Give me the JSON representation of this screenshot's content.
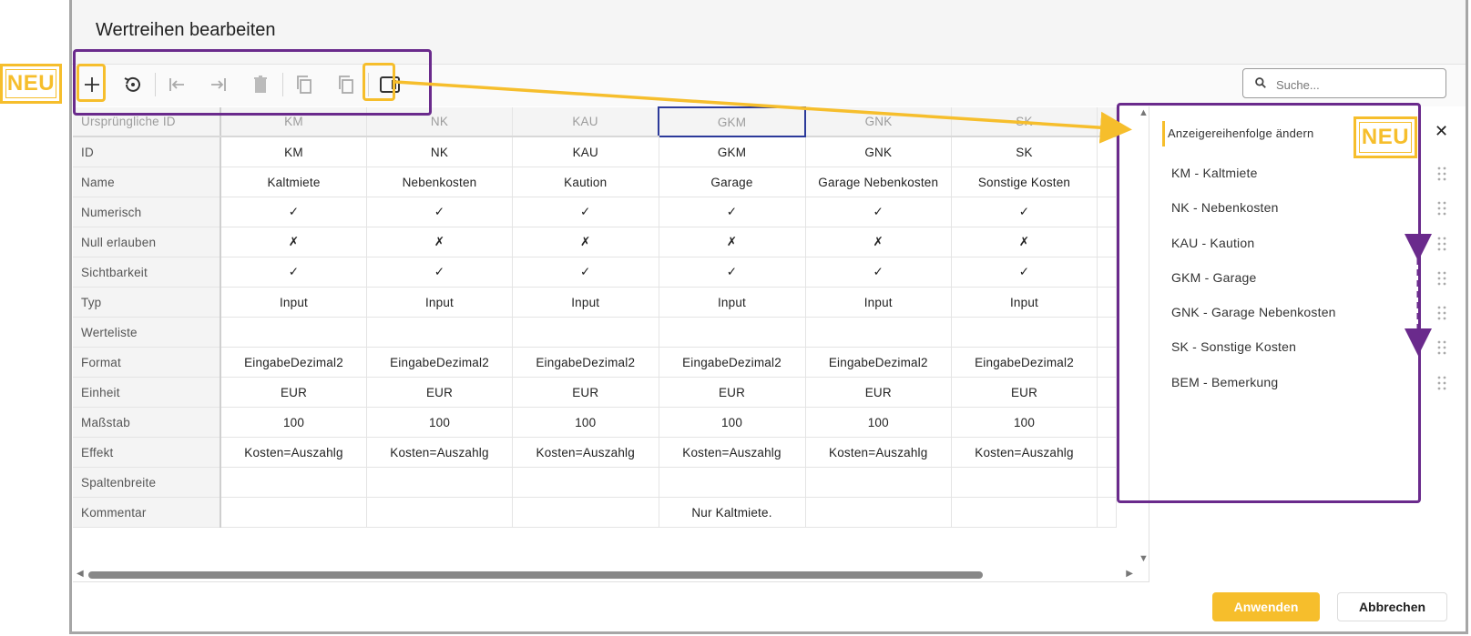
{
  "dialog": {
    "title": "Wertreihen bearbeiten"
  },
  "search": {
    "placeholder": "Suche..."
  },
  "toolbar": {
    "icons": [
      "add-icon",
      "reset-icon",
      "move-left-icon",
      "move-right-icon",
      "delete-icon",
      "copy-icon",
      "duplicate-icon",
      "panel-toggle-icon"
    ]
  },
  "grid": {
    "header_label": "Ursprüngliche ID",
    "columns": [
      "KM",
      "NK",
      "KAU",
      "GKM",
      "GNK",
      "SK"
    ],
    "rows": [
      {
        "label": "ID",
        "cells": [
          "KM",
          "NK",
          "KAU",
          "GKM",
          "GNK",
          "SK"
        ]
      },
      {
        "label": "Name",
        "cells": [
          "Kaltmiete",
          "Nebenkosten",
          "Kaution",
          "Garage",
          "Garage Nebenkosten",
          "Sonstige Kosten"
        ]
      },
      {
        "label": "Numerisch",
        "cells": [
          "✓",
          "✓",
          "✓",
          "✓",
          "✓",
          "✓"
        ]
      },
      {
        "label": "Null erlauben",
        "cells": [
          "✗",
          "✗",
          "✗",
          "✗",
          "✗",
          "✗"
        ]
      },
      {
        "label": "Sichtbarkeit",
        "cells": [
          "✓",
          "✓",
          "✓",
          "✓",
          "✓",
          "✓"
        ]
      },
      {
        "label": "Typ",
        "cells": [
          "Input",
          "Input",
          "Input",
          "Input",
          "Input",
          "Input"
        ]
      },
      {
        "label": "Werteliste",
        "cells": [
          "",
          "",
          "",
          "",
          "",
          ""
        ]
      },
      {
        "label": "Format",
        "cells": [
          "EingabeDezimal2",
          "EingabeDezimal2",
          "EingabeDezimal2",
          "EingabeDezimal2",
          "EingabeDezimal2",
          "EingabeDezimal2"
        ]
      },
      {
        "label": "Einheit",
        "cells": [
          "EUR",
          "EUR",
          "EUR",
          "EUR",
          "EUR",
          "EUR"
        ]
      },
      {
        "label": "Maßstab",
        "cells": [
          "100",
          "100",
          "100",
          "100",
          "100",
          "100"
        ]
      },
      {
        "label": "Effekt",
        "cells": [
          "Kosten=Auszahlg",
          "Kosten=Auszahlg",
          "Kosten=Auszahlg",
          "Kosten=Auszahlg",
          "Kosten=Auszahlg",
          "Kosten=Auszahlg"
        ]
      },
      {
        "label": "Spaltenbreite",
        "cells": [
          "",
          "",
          "",
          "",
          "",
          ""
        ]
      },
      {
        "label": "Kommentar",
        "cells": [
          "",
          "",
          "",
          "Nur Kaltmiete.",
          "",
          ""
        ]
      }
    ]
  },
  "panel": {
    "title": "Anzeigereihenfolge ändern",
    "close": "✕",
    "items": [
      "KM - Kaltmiete",
      "NK - Nebenkosten",
      "KAU - Kaution",
      "GKM - Garage",
      "GNK - Garage Nebenkosten",
      "SK - Sonstige Kosten",
      "BEM - Bemerkung"
    ]
  },
  "buttons": {
    "apply": "Anwenden",
    "cancel": "Abbrechen"
  },
  "badges": {
    "neu_left": "NEU",
    "neu_panel": "NEU"
  },
  "colors": {
    "accent": "#f6be2c",
    "annotation_purple": "#6a2a8c",
    "selection": "#2c3a9a"
  }
}
